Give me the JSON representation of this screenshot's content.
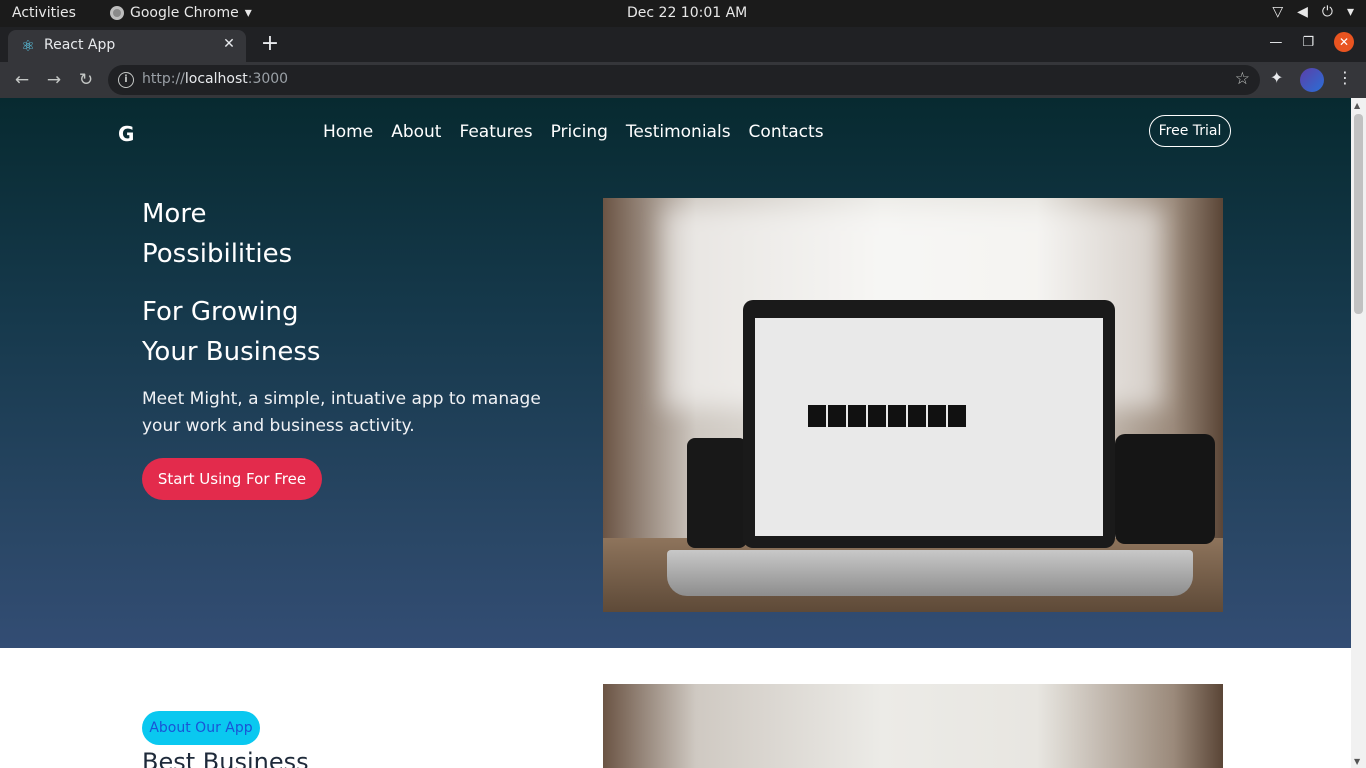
{
  "system_bar": {
    "activities": "Activities",
    "app_menu": "Google Chrome",
    "clock": "Dec 22  10:01 AM"
  },
  "browser": {
    "tab_title": "React App",
    "url_prefix": "http://",
    "url_host": "localhost",
    "url_port": ":3000"
  },
  "site": {
    "logo": "G",
    "nav": [
      "Home",
      "About",
      "Features",
      "Pricing",
      "Testimonials",
      "Contacts"
    ],
    "trial_button": "Free Trial",
    "hero": {
      "title_line1": "More",
      "title_line2": "Possibilities",
      "subtitle_line1": "For Growing",
      "subtitle_line2": "Your Business",
      "description": "Meet Might, a simple, intuative app to manage your work and business activity.",
      "cta": "Start Using For Free"
    },
    "about": {
      "badge": "About Our App",
      "title": "Best Business"
    }
  },
  "colors": {
    "hero_top": "#072a30",
    "hero_bottom": "#334d74",
    "cta": "#e32b4c",
    "badge_bg": "#0ac8f0",
    "badge_text": "#1a54d6"
  }
}
